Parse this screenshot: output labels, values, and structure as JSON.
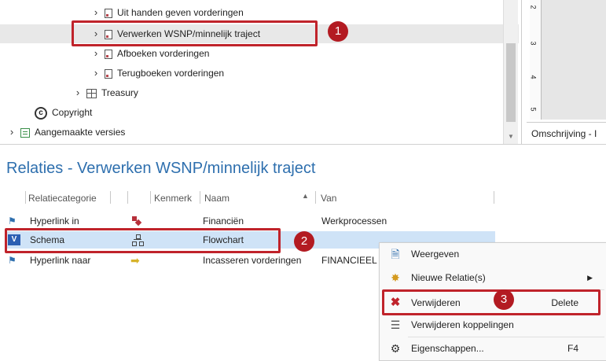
{
  "tree": {
    "items": [
      {
        "label": "Uit handen geven vorderingen"
      },
      {
        "label": "Verwerken WSNP/minnelijk traject"
      },
      {
        "label": "Afboeken vorderingen"
      },
      {
        "label": "Terugboeken vorderingen"
      },
      {
        "label": "Treasury"
      },
      {
        "label": "Copyright"
      },
      {
        "label": "Aangemaakte versies"
      }
    ]
  },
  "preview": {
    "ruler_labels": [
      "2",
      "3",
      "4",
      "5"
    ],
    "omschrijving_label": "Omschrijving - I"
  },
  "relations": {
    "title": "Relaties - Verwerken WSNP/minnelijk traject",
    "columns": {
      "relatiecategorie": "Relatiecategorie",
      "kenmerk": "Kenmerk",
      "naam": "Naam",
      "van": "Van"
    },
    "rows": [
      {
        "category": "Hyperlink in",
        "naam": "Financiën",
        "van": "Werkprocessen"
      },
      {
        "category": "Schema",
        "naam": "Flowchart",
        "van": ""
      },
      {
        "category": "Hyperlink naar",
        "naam": "Incasseren vorderingen",
        "van": "FINANCIEEL N"
      }
    ]
  },
  "context_menu": {
    "items": [
      {
        "label": "Weergeven",
        "shortcut": ""
      },
      {
        "label": "Nieuwe Relatie(s)",
        "shortcut": ""
      },
      {
        "label": "Verwijderen",
        "shortcut": "Delete"
      },
      {
        "label": "Verwijderen koppelingen",
        "shortcut": ""
      },
      {
        "label": "Eigenschappen...",
        "shortcut": "F4"
      }
    ]
  },
  "badges": {
    "one": "1",
    "two": "2",
    "three": "3"
  },
  "colors": {
    "accent": "#2e6fae",
    "highlight": "#c0232b",
    "badge": "#b31b22"
  }
}
